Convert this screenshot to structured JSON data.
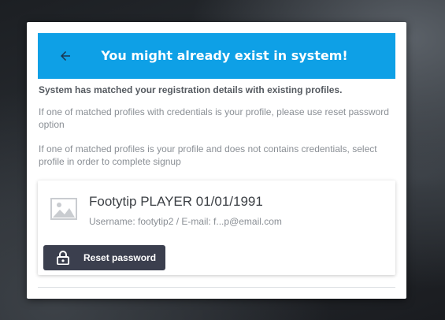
{
  "dialog": {
    "title": "You might already exist in system!",
    "lead": "System has matched your registration details with existing profiles.",
    "paragraphs": [
      "If one of matched profiles with credentials is your profile, please use reset password option",
      "If one of matched profiles is your profile and does not contains credentials, select profile in order to complete signup"
    ]
  },
  "profile": {
    "name": "Footytip PLAYER 01/01/1991",
    "details": "Username: footytip2 / E-mail: f...p@email.com",
    "reset_label": "Reset password"
  },
  "icons": {
    "back": "arrow-left-icon",
    "avatar": "image-placeholder-icon",
    "lock": "lock-icon"
  },
  "colors": {
    "header_bg": "#0ea0e6",
    "button_bg": "#3b3f4e",
    "text_dark": "#555a60",
    "text_muted": "#8a8f95"
  }
}
